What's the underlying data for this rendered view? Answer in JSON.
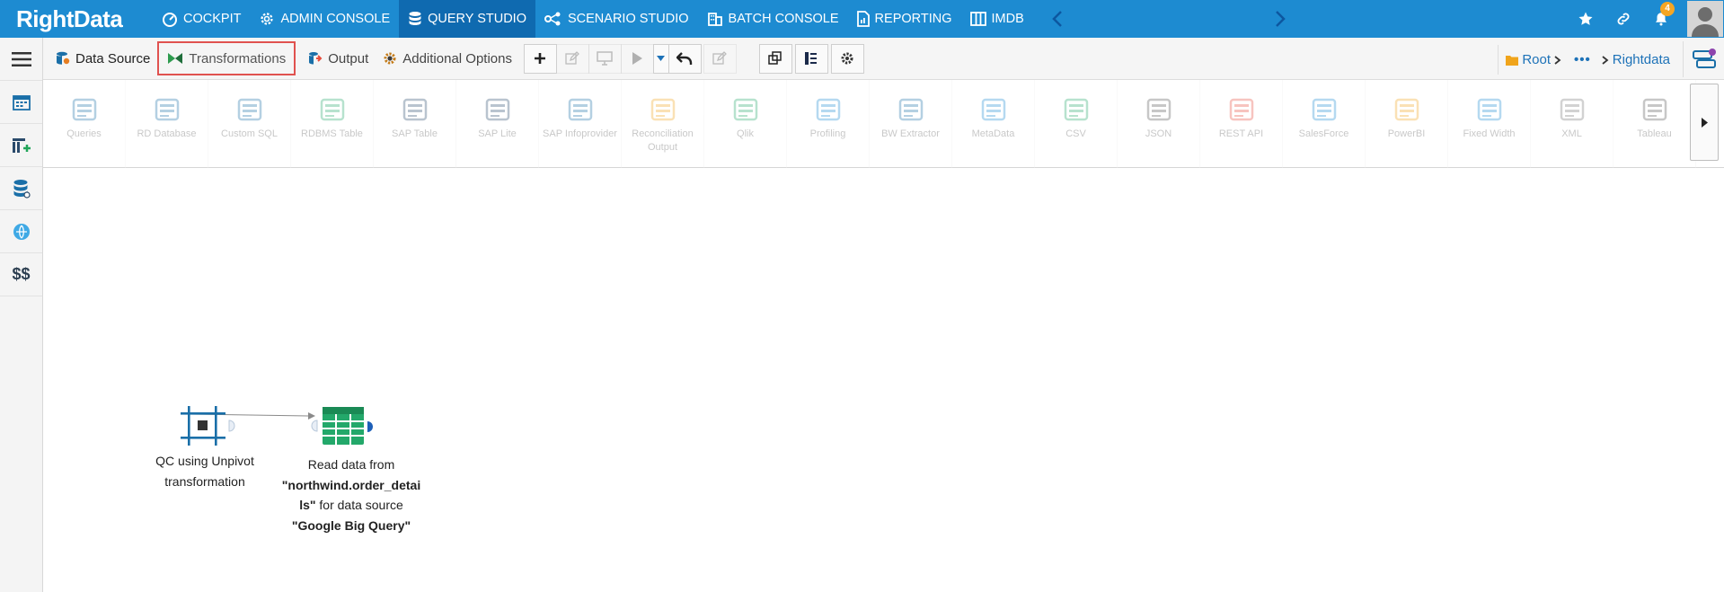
{
  "app": {
    "logo_text": "RightData",
    "brand_color": "#1d8bd1",
    "active_color": "#0f6ab0"
  },
  "nav": {
    "items": [
      {
        "label": "COCKPIT",
        "icon": "speedometer-icon"
      },
      {
        "label": "ADMIN CONSOLE",
        "icon": "gear-icon"
      },
      {
        "label": "QUERY STUDIO",
        "icon": "database-icon",
        "active": true
      },
      {
        "label": "SCENARIO STUDIO",
        "icon": "flow-icon"
      },
      {
        "label": "BATCH CONSOLE",
        "icon": "building-icon"
      },
      {
        "label": "REPORTING",
        "icon": "report-icon"
      },
      {
        "label": "IMDB",
        "icon": "columns-icon"
      }
    ],
    "notification_count": "4"
  },
  "sidebar": {
    "items": [
      {
        "icon": "hamburger-menu-icon"
      },
      {
        "icon": "calendar-icon"
      },
      {
        "icon": "table-add-icon"
      },
      {
        "icon": "database-stack-icon"
      },
      {
        "icon": "globe-link-icon"
      },
      {
        "icon": "dollar-icon",
        "label": "$$"
      }
    ]
  },
  "toolbar": {
    "tabs": {
      "data_source": "Data Source",
      "transformations": "Transformations",
      "output": "Output",
      "additional_options": "Additional Options"
    },
    "breadcrumb": {
      "root": "Root",
      "more": "•••",
      "current": "Rightdata"
    }
  },
  "ribbon": {
    "items": [
      {
        "label": "Queries",
        "icon": "queries-icon"
      },
      {
        "label": "RD Database",
        "icon": "rd-database-icon"
      },
      {
        "label": "Custom SQL",
        "icon": "custom-sql-icon"
      },
      {
        "label": "RDBMS Table",
        "icon": "rdbms-table-icon"
      },
      {
        "label": "SAP Table",
        "icon": "sap-table-icon"
      },
      {
        "label": "SAP Lite",
        "icon": "sap-lite-icon"
      },
      {
        "label": "SAP Infoprovider",
        "icon": "sap-infoprovider-icon"
      },
      {
        "label": "Reconciliation Output",
        "icon": "reconciliation-output-icon"
      },
      {
        "label": "Qlik",
        "icon": "qlik-icon"
      },
      {
        "label": "Profiling",
        "icon": "profiling-icon"
      },
      {
        "label": "BW Extractor",
        "icon": "bw-extractor-icon"
      },
      {
        "label": "MetaData",
        "icon": "metadata-icon"
      },
      {
        "label": "CSV",
        "icon": "csv-icon"
      },
      {
        "label": "JSON",
        "icon": "json-icon"
      },
      {
        "label": "REST API",
        "icon": "rest-api-icon"
      },
      {
        "label": "SalesForce",
        "icon": "salesforce-icon"
      },
      {
        "label": "PowerBI",
        "icon": "powerbi-icon"
      },
      {
        "label": "Fixed Width",
        "icon": "fixed-width-icon"
      },
      {
        "label": "XML",
        "icon": "xml-icon"
      },
      {
        "label": "Tableau",
        "icon": "tableau-icon"
      }
    ]
  },
  "canvas": {
    "node1": {
      "line1": "QC using Unpivot",
      "line2": "transformation"
    },
    "node2": {
      "line1": "Read data from",
      "line2": "\"northwind.order_detai",
      "line3_bold": "ls\"",
      "line3_rest": " for data source",
      "line4": "\"Google Big Query\""
    }
  }
}
